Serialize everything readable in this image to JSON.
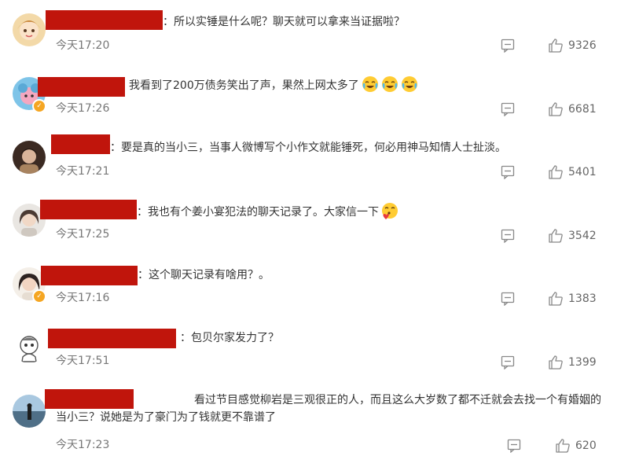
{
  "comments": [
    {
      "text": "：所以实锤是什么呢？聊天就可以拿来当证据啦？",
      "time": "今天17:20",
      "likes": "9326",
      "avatar_icon": "cartoon-girl-avatar",
      "emoji_icons": []
    },
    {
      "text": "我看到了200万债务笑出了声，果然上网太多了",
      "time": "今天17:26",
      "likes": "6681",
      "avatar_icon": "blue-flower-avatar",
      "verified": true,
      "emoji_icons": [
        "crying-laughing-emoji",
        "crying-laughing-emoji",
        "crying-laughing-emoji"
      ]
    },
    {
      "text": "：要是真的当小三，当事人微博写个小作文就能锤死，何必用神马知情人士扯淡。",
      "time": "今天17:21",
      "likes": "5401",
      "avatar_icon": "person-photo-avatar",
      "emoji_icons": []
    },
    {
      "text": "：我也有个姜小宴犯法的聊天记录了。大家信一下",
      "time": "今天17:25",
      "likes": "3542",
      "avatar_icon": "girl-photo-avatar",
      "emoji_icons": [
        "kissing-heart-emoji"
      ]
    },
    {
      "text": "：这个聊天记录有啥用？。",
      "time": "今天17:16",
      "likes": "1383",
      "avatar_icon": "woman-photo-avatar",
      "verified": true,
      "emoji_icons": []
    },
    {
      "text": "：包贝尔家发力了？",
      "time": "今天17:51",
      "likes": "1399",
      "avatar_icon": "sketch-cartoon-avatar",
      "emoji_icons": []
    },
    {
      "text": "看过节目感觉柳岩是三观很正的人，而且这么大岁数了都不迁就会去找一个有婚姻的当小三？说她是为了豪门为了钱就更不靠谱了",
      "time": "今天17:23",
      "likes": "620",
      "avatar_icon": "seaside-photo-avatar",
      "emoji_icons": []
    }
  ],
  "icons": {
    "reply": "comment-reply-icon",
    "like": "thumbs-up-icon"
  },
  "colors": {
    "redaction": "#c0150c",
    "verified": "#f5a623"
  }
}
